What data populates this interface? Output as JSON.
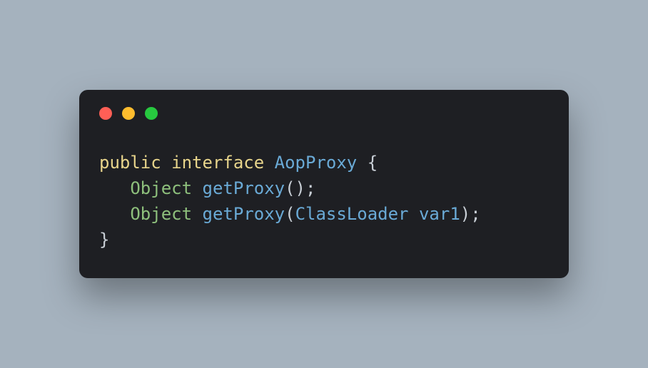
{
  "code": {
    "line1": {
      "kw1": "public",
      "kw2": "interface",
      "typeName": "AopProxy",
      "brace": " {"
    },
    "line2": {
      "indent": "   ",
      "returnType": "Object",
      "method": "getProxy",
      "parens": "();"
    },
    "line3": {
      "indent": "   ",
      "returnType": "Object",
      "method": "getProxy",
      "open": "(",
      "paramType": "ClassLoader",
      "paramName": "var1",
      "close": ");"
    },
    "line4": {
      "brace": "}"
    }
  }
}
